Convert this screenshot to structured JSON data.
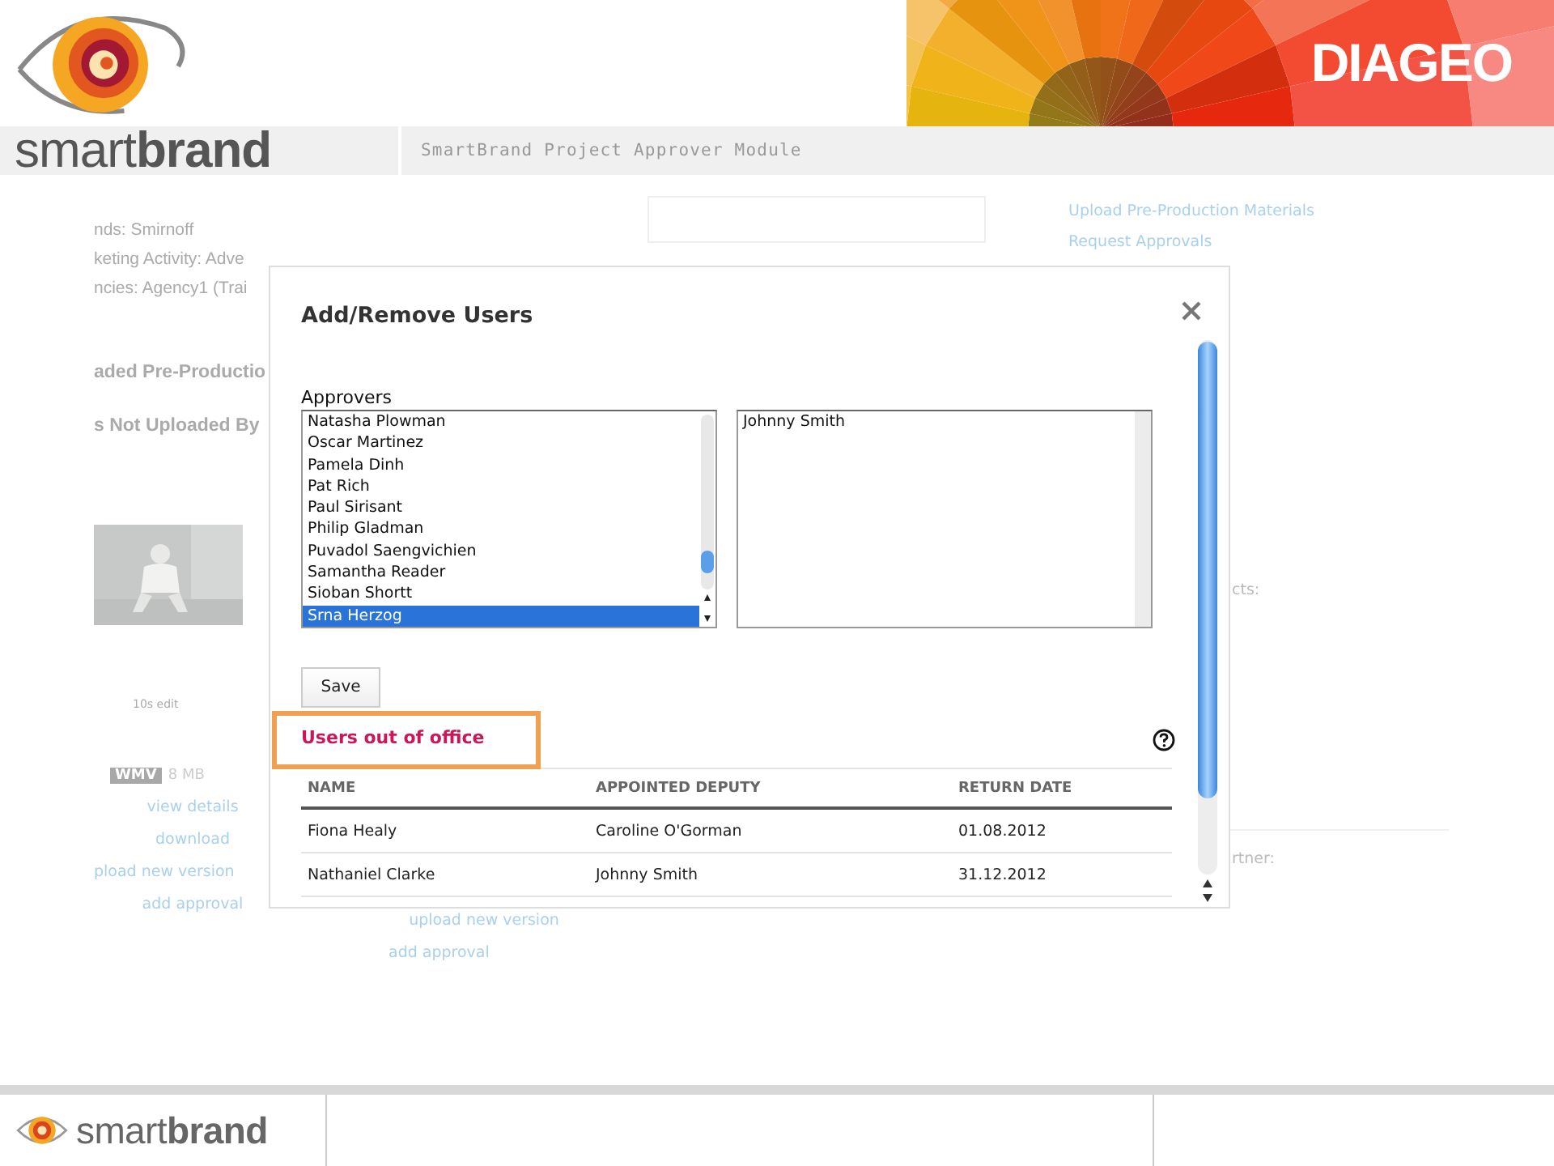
{
  "header": {
    "brand": "DIAGEO",
    "product": "smart**brand**",
    "module_title": "SmartBrand Project Approver Module"
  },
  "background": {
    "details": [
      "nds: Smirnoff",
      "keting Activity: Adve",
      "ncies: Agency1 (Trai"
    ],
    "headings": [
      "aded Pre-Productio",
      "s Not Uploaded By"
    ],
    "thumbnail": {
      "kind": "picture",
      "caption": "10s edit"
    },
    "file": {
      "format": "WMV",
      "size": "8 MB"
    },
    "links_left": [
      "view details",
      "download",
      "pload new version",
      "add approval"
    ],
    "links_mid": [
      "upload new version",
      "add approval"
    ],
    "actions": [
      "Upload Pre-Production Materials",
      "Request Approvals"
    ],
    "labels": [
      "cts:",
      "rtner:"
    ]
  },
  "dialog": {
    "title": "Add/Remove Users",
    "approvers_label": "Approvers",
    "available": [
      {
        "name": "Natasha Plowman",
        "selected": false
      },
      {
        "name": "Oscar Martinez",
        "selected": false
      },
      {
        "name": "Pamela Dinh",
        "selected": false
      },
      {
        "name": "Pat Rich",
        "selected": false
      },
      {
        "name": "Paul Sirisant",
        "selected": false
      },
      {
        "name": "Philip Gladman",
        "selected": false
      },
      {
        "name": "Puvadol Saengvichien",
        "selected": false
      },
      {
        "name": "Samantha Reader",
        "selected": false
      },
      {
        "name": "Sioban Shortt",
        "selected": false
      },
      {
        "name": "Srna Herzog",
        "selected": true
      }
    ],
    "assigned": [
      {
        "name": "Johnny Smith",
        "selected": false
      }
    ],
    "save": "Save",
    "out_of_office": {
      "title": "Users out of office",
      "highlighted": true,
      "columns": [
        "NAME",
        "APPOINTED DEPUTY",
        "RETURN DATE"
      ],
      "rows": [
        [
          "Fiona Healy",
          "Caroline O'Gorman",
          "01.08.2012"
        ],
        [
          "Nathaniel Clarke",
          "Johnny Smith",
          "31.12.2012"
        ]
      ]
    }
  },
  "footer": {
    "product": "smart**brand**"
  }
}
